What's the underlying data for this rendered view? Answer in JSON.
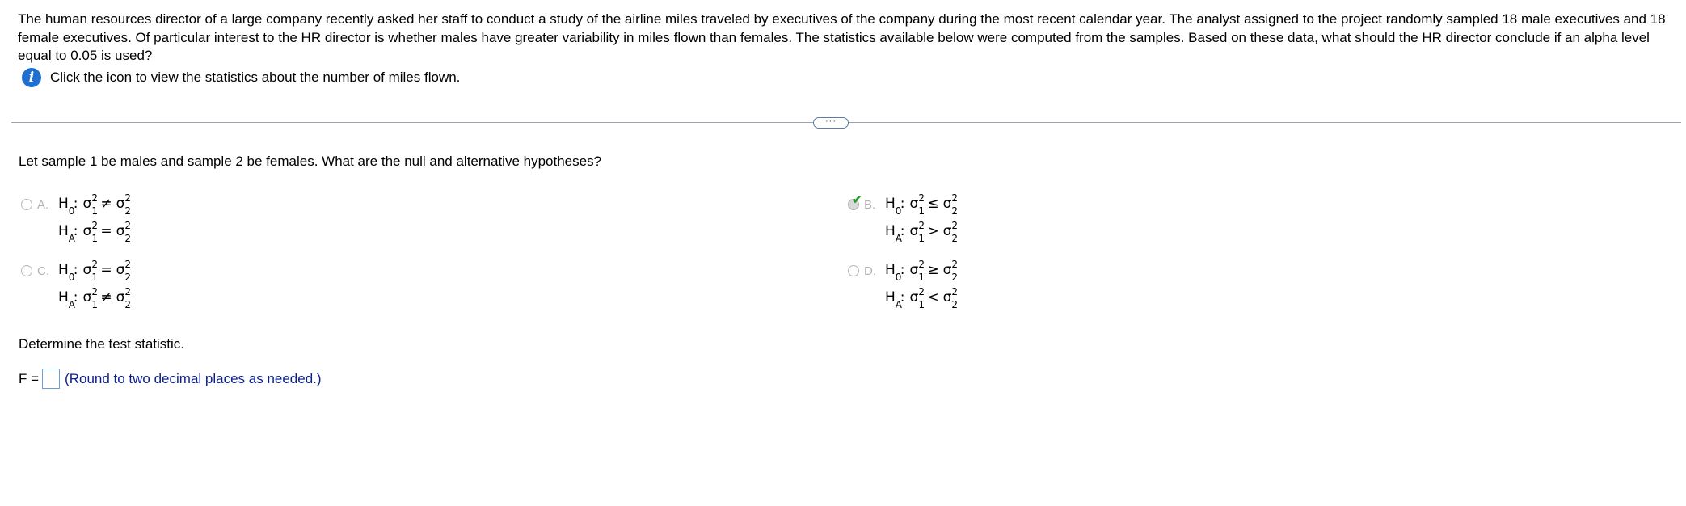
{
  "problem_text": "The human resources director of a large company recently asked her staff to conduct a study of the airline miles traveled by executives of the company during the most recent calendar year. The analyst assigned to the project randomly sampled 18 male executives and 18 female executives. Of particular interest to the HR director is whether males have greater variability in miles flown than females. The statistics available below were computed from the samples. Based on these data, what should the HR director conclude if an alpha level equal to 0.05 is used?",
  "info_link_text": "Click the icon to view the statistics about the number of miles flown.",
  "expand_label": "···",
  "question_text": "Let sample 1 be males and sample 2 be females. What are the null and alternative hypotheses?",
  "choices": [
    {
      "letter": "A.",
      "h0_op": "≠",
      "ha_op": "=",
      "selected": false
    },
    {
      "letter": "B.",
      "h0_op": "≤",
      "ha_op": ">",
      "selected": true
    },
    {
      "letter": "C.",
      "h0_op": "=",
      "ha_op": "≠",
      "selected": false
    },
    {
      "letter": "D.",
      "h0_op": "≥",
      "ha_op": "<",
      "selected": false
    }
  ],
  "symbols": {
    "h0": "H",
    "h0_sub": "0",
    "ha": "H",
    "ha_sub": "A",
    "sigma": "σ",
    "sup": "2",
    "sub1": "1",
    "sub2": "2",
    "colon": ":"
  },
  "check_mark": "✔",
  "determine_text": "Determine the test statistic.",
  "answer_label": "F =",
  "answer_value": "",
  "answer_hint": "(Round to two decimal places as needed.)",
  "colors": {
    "info_icon": "#1f6fd0",
    "correct_check": "#2c9a2c",
    "hint_text": "#0b1f8e",
    "divider": "#9aa5b1"
  },
  "icons": {
    "info": "info-icon",
    "check": "check-icon"
  }
}
